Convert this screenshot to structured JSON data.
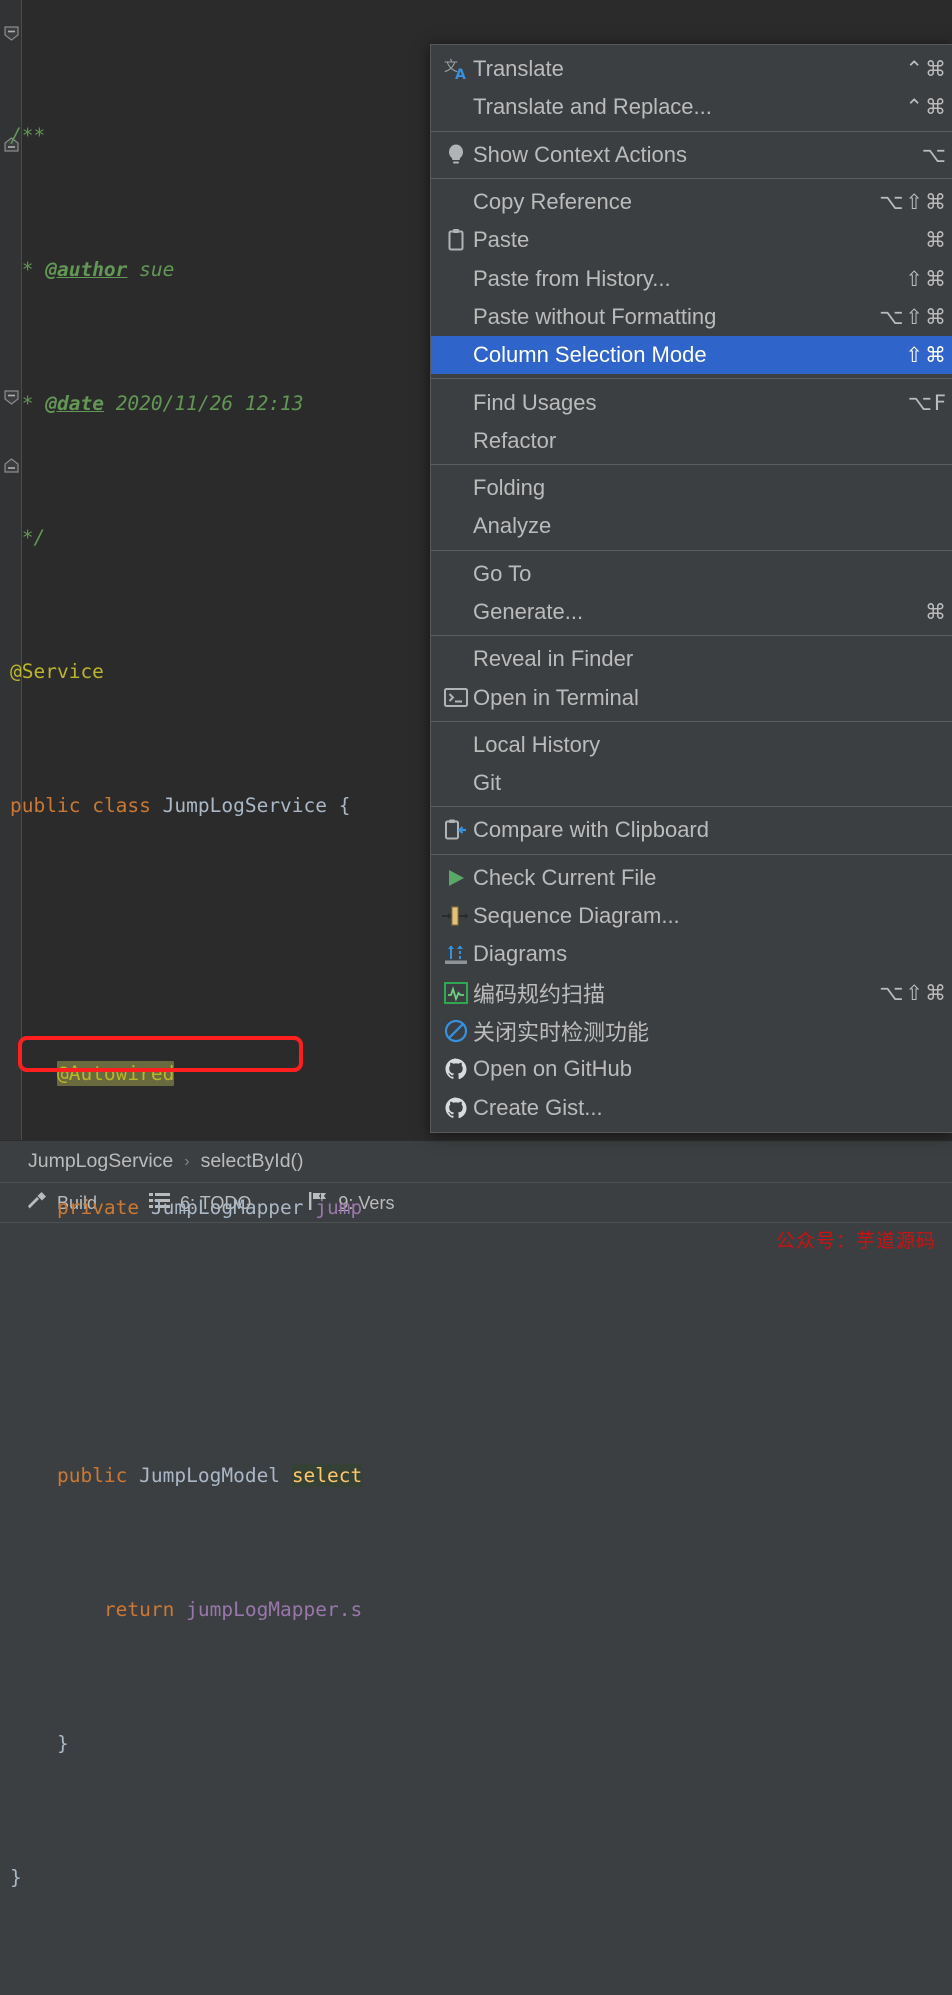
{
  "editor": {
    "code_lines": [
      {
        "id": "l1",
        "text": "/**"
      },
      {
        "id": "l2",
        "text": " * @author sue"
      },
      {
        "id": "l3",
        "text": " * @date 2020/11/26 12:13"
      },
      {
        "id": "l4",
        "text": " */"
      },
      {
        "id": "l5",
        "text": "@Service"
      },
      {
        "id": "l6",
        "text": "public class JumpLogService {"
      },
      {
        "id": "l7",
        "text": ""
      },
      {
        "id": "l8",
        "text": "    @Autowired"
      },
      {
        "id": "l9",
        "text": "    private JumpLogMapper jump"
      },
      {
        "id": "l10",
        "text": ""
      },
      {
        "id": "l11",
        "text": "    public JumpLogModel select"
      },
      {
        "id": "l12",
        "text": "        return jumpLogMapper.s"
      },
      {
        "id": "l13",
        "text": "    }"
      },
      {
        "id": "l14",
        "text": "}"
      }
    ],
    "tokens": {
      "comment_open": "/**",
      "author_tag": "@author",
      "author_value": "sue",
      "date_tag": "@date",
      "date_value": "2020/11/26 12:13",
      "comment_close": "*/",
      "service_annotation": "@Service",
      "kw_public": "public",
      "kw_class": "class",
      "class_name": "JumpLogService",
      "brace_open": "{",
      "autowired_annotation": "@Autowired",
      "kw_private": "private",
      "mapper_type": "JumpLogMapper",
      "mapper_field_partial": "jump",
      "model_type": "JumpLogModel",
      "method_partial": "select",
      "kw_return": "return",
      "mapper_ref_partial": "jumpLogMapper.s",
      "brace_close_inner": "}",
      "brace_close_outer": "}"
    },
    "colors": {
      "background": "#2b2b2b",
      "gutter": "#313335",
      "comment": "#629755",
      "annotation": "#bbb529",
      "keyword": "#cc7832",
      "identifier": "#a9b7c6",
      "field": "#9876aa",
      "method": "#ffc66d",
      "selection_highlight": "#344134",
      "annotation_highlight": "#6a6a3f",
      "error_squiggle": "#cc4040"
    }
  },
  "breadcrumb": {
    "items": [
      "JumpLogService",
      "selectById()"
    ],
    "separator": "›"
  },
  "bottom_bar": {
    "buttons": [
      {
        "icon": "hammer-icon",
        "num": "",
        "label": "Build"
      },
      {
        "icon": "todo-list-icon",
        "num": "6",
        "label": ": TODO"
      },
      {
        "icon": "version-control-icon",
        "num": "9",
        "label": ": Vers"
      }
    ]
  },
  "watermark": {
    "text": "公众号：芋道源码",
    "color": "#cc1111"
  },
  "context_menu": {
    "accent_selected": "#2f65ca",
    "annotation_box_color": "#ff1f1f",
    "groups": [
      {
        "id": "g1",
        "items": [
          {
            "id": "translate",
            "label": "Translate",
            "icon": "translate-icon",
            "shortcut": "⌃⌘",
            "selected": false
          },
          {
            "id": "translate-and-replace",
            "label": "Translate and Replace...",
            "icon": "none",
            "shortcut": "⌃⌘",
            "selected": false
          }
        ]
      },
      {
        "id": "g2",
        "items": [
          {
            "id": "show-context-actions",
            "label": "Show Context Actions",
            "icon": "lightbulb-icon",
            "shortcut": "⌥",
            "selected": false
          }
        ]
      },
      {
        "id": "g3",
        "items": [
          {
            "id": "copy-reference",
            "label": "Copy Reference",
            "icon": "none",
            "shortcut": "⌥⇧⌘",
            "selected": false
          },
          {
            "id": "paste",
            "label": "Paste",
            "icon": "clipboard-icon",
            "shortcut": "⌘",
            "selected": false
          },
          {
            "id": "paste-from-history",
            "label": "Paste from History...",
            "icon": "none",
            "shortcut": "⇧⌘",
            "selected": false
          },
          {
            "id": "paste-without-formatting",
            "label": "Paste without Formatting",
            "icon": "none",
            "shortcut": "⌥⇧⌘",
            "selected": false
          },
          {
            "id": "column-selection-mode",
            "label": "Column Selection Mode",
            "icon": "none",
            "shortcut": "⇧⌘",
            "selected": true
          }
        ]
      },
      {
        "id": "g4",
        "items": [
          {
            "id": "find-usages",
            "label": "Find Usages",
            "icon": "none",
            "shortcut": "⌥F",
            "selected": false
          },
          {
            "id": "refactor",
            "label": "Refactor",
            "icon": "none",
            "shortcut": "",
            "selected": false
          }
        ]
      },
      {
        "id": "g5",
        "items": [
          {
            "id": "folding",
            "label": "Folding",
            "icon": "none",
            "shortcut": "",
            "selected": false
          },
          {
            "id": "analyze",
            "label": "Analyze",
            "icon": "none",
            "shortcut": "",
            "selected": false
          }
        ]
      },
      {
        "id": "g6",
        "items": [
          {
            "id": "go-to",
            "label": "Go To",
            "icon": "none",
            "shortcut": "",
            "selected": false
          },
          {
            "id": "generate",
            "label": "Generate...",
            "icon": "none",
            "shortcut": "⌘",
            "selected": false
          }
        ]
      },
      {
        "id": "g7",
        "items": [
          {
            "id": "reveal-in-finder",
            "label": "Reveal in Finder",
            "icon": "none",
            "shortcut": "",
            "selected": false
          },
          {
            "id": "open-in-terminal",
            "label": "Open in Terminal",
            "icon": "terminal-icon",
            "shortcut": "",
            "selected": false
          }
        ]
      },
      {
        "id": "g8",
        "items": [
          {
            "id": "local-history",
            "label": "Local History",
            "icon": "none",
            "shortcut": "",
            "selected": false
          },
          {
            "id": "git",
            "label": "Git",
            "icon": "none",
            "shortcut": "",
            "selected": false
          }
        ]
      },
      {
        "id": "g9",
        "items": [
          {
            "id": "compare-with-clipboard",
            "label": "Compare with Clipboard",
            "icon": "compare-clipboard-icon",
            "shortcut": "",
            "selected": false
          }
        ]
      },
      {
        "id": "g10",
        "items": [
          {
            "id": "check-current-file",
            "label": "Check Current File",
            "icon": "play-green-icon",
            "shortcut": "",
            "selected": false
          },
          {
            "id": "sequence-diagram",
            "label": "Sequence Diagram...",
            "icon": "sequence-diagram-icon",
            "shortcut": "",
            "selected": false,
            "annotated": true
          },
          {
            "id": "diagrams",
            "label": "Diagrams",
            "icon": "diagrams-icon",
            "shortcut": "",
            "selected": false
          },
          {
            "id": "coding-convention-scan",
            "label": "编码规约扫描",
            "icon": "scan-green-icon",
            "shortcut": "⌥⇧⌘",
            "selected": false,
            "cjk": true
          },
          {
            "id": "disable-realtime-detection",
            "label": "关闭实时检测功能",
            "icon": "forbidden-blue-icon",
            "shortcut": "",
            "selected": false,
            "cjk": true
          },
          {
            "id": "open-on-github",
            "label": "Open on GitHub",
            "icon": "github-icon",
            "shortcut": "",
            "selected": false
          },
          {
            "id": "create-gist",
            "label": "Create Gist...",
            "icon": "github-icon",
            "shortcut": "",
            "selected": false
          }
        ]
      }
    ]
  }
}
